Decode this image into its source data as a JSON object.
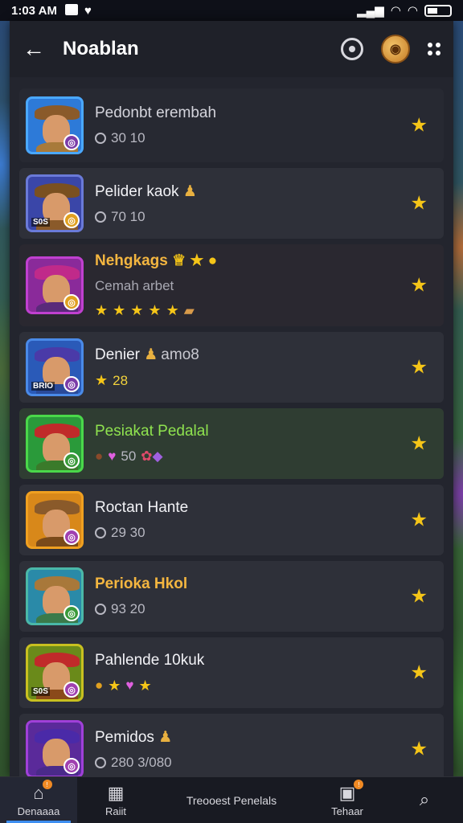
{
  "status_bar": {
    "time": "1:03 AM"
  },
  "appbar": {
    "title": "Noablan",
    "icons": [
      "back-arrow-icon",
      "search-badge-icon",
      "coin-avatar-icon",
      "dots-menu-icon"
    ]
  },
  "rows": [
    {
      "name": "Pedonbt erembah",
      "sub": "30 10",
      "sub_prefix": "clock-icon",
      "avatar_tag": "",
      "colors": {
        "border": "#4aa8ff",
        "bg": "#2d7ad8",
        "hat": "#8a5a2a",
        "body": "#a87a3a",
        "badge": "#7b3ca8"
      }
    },
    {
      "name": "Pelider kaok",
      "sub": "70 10",
      "sub_prefix": "clock-icon",
      "avatar_tag": "S0S",
      "colors": {
        "border": "#6a7ad8",
        "bg": "#3a46a8",
        "hat": "#7a5020",
        "body": "#8a5a2a",
        "badge": "#e0a020"
      }
    },
    {
      "name": "Nehgkags",
      "sub": "Cemah arbet",
      "sub_prefix": "",
      "avatar_tag": "",
      "colors": {
        "border": "#c040d0",
        "bg": "#8a2a9a",
        "hat": "#c02a8a",
        "body": "#5a2a7a",
        "badge": "#e0a020"
      }
    },
    {
      "name": "Denier",
      "name_suffix": "amo8",
      "sub": "28",
      "sub_prefix": "star",
      "avatar_tag": "BRIO",
      "colors": {
        "border": "#4a8ae8",
        "bg": "#2a5ab8",
        "hat": "#4a3aa8",
        "body": "#2a4a9a",
        "badge": "#7b3ca8"
      }
    },
    {
      "name": "Pesiakat Pedalal",
      "sub": "50",
      "sub_prefix": "gems",
      "avatar_tag": "",
      "colors": {
        "border": "#4ad84a",
        "bg": "#2a9a3a",
        "hat": "#c02a2a",
        "body": "#3a7a2a",
        "badge": "#3a9a3a"
      }
    },
    {
      "name": "Roctan Hante",
      "sub": "29 30",
      "sub_prefix": "clock-icon",
      "avatar_tag": "",
      "colors": {
        "border": "#f0a020",
        "bg": "#d8881a",
        "hat": "#8a5a2a",
        "body": "#7a4a1a",
        "badge": "#a040b0"
      }
    },
    {
      "name": "Perioka Hkol",
      "sub": "93 20",
      "sub_prefix": "clock-icon",
      "avatar_tag": "",
      "colors": {
        "border": "#4ab8a8",
        "bg": "#2a8aa8",
        "hat": "#a8783a",
        "body": "#3a7a4a",
        "badge": "#3a9a3a"
      }
    },
    {
      "name": "Pahlende 10kuk",
      "sub": "",
      "sub_prefix": "mixed",
      "avatar_tag": "S0S",
      "colors": {
        "border": "#c8c020",
        "bg": "#6a8a1a",
        "hat": "#c02a2a",
        "body": "#8a4a1a",
        "badge": "#a040b0"
      }
    },
    {
      "name": "Pemidos",
      "sub": "280  3/080",
      "sub_prefix": "clock-icon",
      "avatar_tag": "",
      "colors": {
        "border": "#a040d8",
        "bg": "#5a2a9a",
        "hat": "#4a2aa8",
        "body": "#4a2a8a",
        "badge": "#a040b0"
      }
    }
  ],
  "bottom_nav": {
    "items": [
      {
        "label": "Denaaaa",
        "icon": "home-icon",
        "badge": true
      },
      {
        "label": "Raiit",
        "icon": "grid-icon",
        "badge": false
      },
      {
        "label": "Treooest Penelals",
        "icon": "",
        "badge": false
      },
      {
        "label": "Tehaar",
        "icon": "bag-icon",
        "badge": true
      },
      {
        "label": "",
        "icon": "search-icon",
        "badge": false
      }
    ]
  },
  "accent": "#3d8ef0",
  "star_color": "#f5c518"
}
